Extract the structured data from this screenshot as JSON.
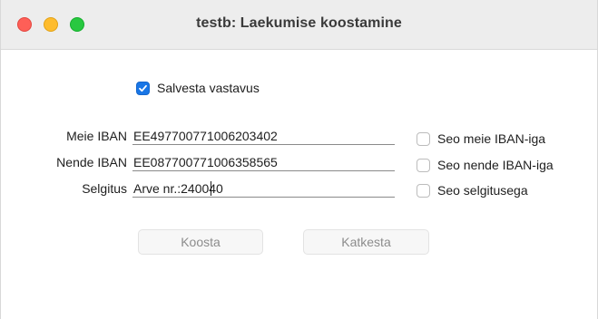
{
  "window": {
    "title": "testb: Laekumise koostamine"
  },
  "save_match": {
    "label": "Salvesta vastavus",
    "checked": true
  },
  "fields": {
    "our_iban": {
      "label": "Meie IBAN",
      "value": "EE497700771006203402"
    },
    "their_iban": {
      "label": "Nende IBAN",
      "value": "EE087700771006358565"
    },
    "description": {
      "label": "Selgitus",
      "value": "Arve nr.:240040"
    }
  },
  "links": {
    "link_our_iban": {
      "label": "Seo meie IBAN-iga",
      "checked": false
    },
    "link_their_iban": {
      "label": "Seo nende IBAN-iga",
      "checked": false
    },
    "link_description": {
      "label": "Seo selgitusega",
      "checked": false
    }
  },
  "buttons": {
    "compose": "Koosta",
    "cancel": "Katkesta"
  },
  "colors": {
    "accent": "#1976e6",
    "close": "#fe5f57",
    "minimize": "#febc2e",
    "zoom": "#28c840"
  }
}
